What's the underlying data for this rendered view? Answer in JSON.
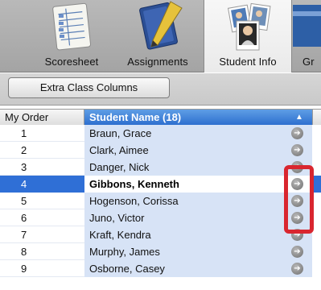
{
  "tabs": [
    {
      "label": "Scoresheet",
      "icon": "scoresheet-icon"
    },
    {
      "label": "Assignments",
      "icon": "assignments-icon"
    },
    {
      "label": "Student Info",
      "icon": "student-photos-icon",
      "selected": true
    },
    {
      "label": "Gr",
      "icon": "grades-icon"
    }
  ],
  "toolbar": {
    "extra_columns_label": "Extra Class Columns"
  },
  "table": {
    "col_order_header": "My Order",
    "col_name_header": "Student Name (18)",
    "sort_indicator": "▲",
    "rows": [
      {
        "order": "1",
        "name": "Braun, Grace"
      },
      {
        "order": "2",
        "name": "Clark, Aimee"
      },
      {
        "order": "3",
        "name": "Danger, Nick"
      },
      {
        "order": "4",
        "name": "Gibbons, Kenneth",
        "selected": true
      },
      {
        "order": "5",
        "name": "Hogenson, Corissa"
      },
      {
        "order": "6",
        "name": "Juno, Victor"
      },
      {
        "order": "7",
        "name": "Kraft, Kendra"
      },
      {
        "order": "8",
        "name": "Murphy, James"
      },
      {
        "order": "9",
        "name": "Osborne, Casey"
      }
    ],
    "row_action_icon": "go-arrow-icon"
  },
  "colors": {
    "selection_blue": "#2f6fd6",
    "header_blue": "#3a7cd8",
    "name_column_tint": "#d7e3f6",
    "highlight_red": "#d9262f"
  }
}
